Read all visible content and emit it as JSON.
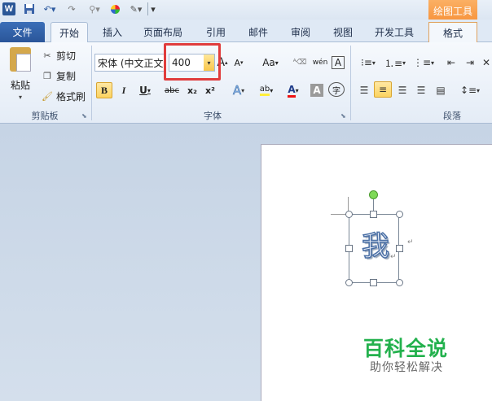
{
  "quick_access": {
    "logo": "W",
    "more": "▾"
  },
  "context_tab_header": "绘图工具",
  "tabs": [
    {
      "label": "文件"
    },
    {
      "label": "开始"
    },
    {
      "label": "插入"
    },
    {
      "label": "页面布局"
    },
    {
      "label": "引用"
    },
    {
      "label": "邮件"
    },
    {
      "label": "审阅"
    },
    {
      "label": "视图"
    },
    {
      "label": "开发工具"
    },
    {
      "label": "格式"
    }
  ],
  "clipboard": {
    "paste": "粘贴",
    "cut": "剪切",
    "copy": "复制",
    "format_painter": "格式刷",
    "group_label": "剪贴板"
  },
  "font": {
    "name": "宋体 (中文正文)",
    "size": "400",
    "grow": "A",
    "shrink": "A",
    "change_case": "Aa",
    "phonetic_guide": "wén",
    "char_border": "A",
    "bold": "B",
    "italic": "I",
    "underline": "U",
    "strikethrough": "abc",
    "subscript": "x₂",
    "superscript": "x²",
    "text_effects": "A",
    "font_color": "A",
    "char_shading": "A",
    "enclosed_char": "字",
    "group_label": "字体"
  },
  "paragraph": {
    "group_label": "段落"
  },
  "document": {
    "character": "我",
    "paragraph_mark": "↵"
  },
  "watermark": {
    "title": "百科全说",
    "subtitle": "助你轻松解决"
  },
  "colors": {
    "highlight": "#e03c3c",
    "watermark_green": "#23b14d",
    "file_tab": "#2a5599",
    "context_tab": "#f7943d"
  }
}
